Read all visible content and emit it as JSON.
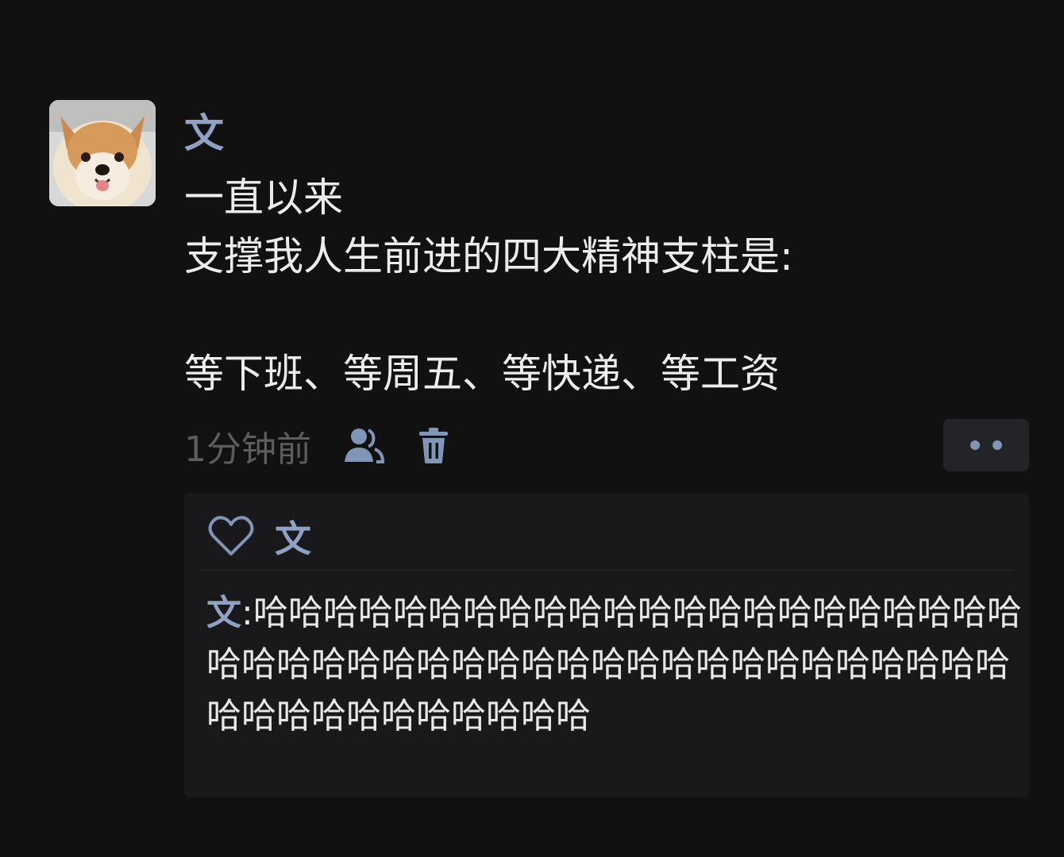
{
  "post": {
    "author": "文",
    "content_lines": [
      "一直以来",
      "支撑我人生前进的四大精神支柱是:",
      "",
      "等下班、等周五、等快递、等工资"
    ],
    "time": "1分钟前",
    "avatar_icon": "dog-avatar",
    "privacy_icon": "person-icon",
    "delete_icon": "trash-icon",
    "more_icon": "more-dots-icon"
  },
  "interactions": {
    "like_icon": "heart-icon",
    "likers": "文",
    "comments": [
      {
        "author": "文",
        "separator": ":",
        "text": "哈哈哈哈哈哈哈哈哈哈哈哈哈哈哈哈哈哈哈哈哈哈哈哈哈哈哈哈哈哈哈哈哈哈哈哈哈哈哈哈哈哈哈哈哈哈哈哈哈哈哈哈哈哈哈哈"
      }
    ]
  },
  "colors": {
    "background": "#111111",
    "name": "#8fa2c4",
    "text": "#ececec",
    "muted": "#5d5d5d",
    "panel": "#19191b"
  }
}
